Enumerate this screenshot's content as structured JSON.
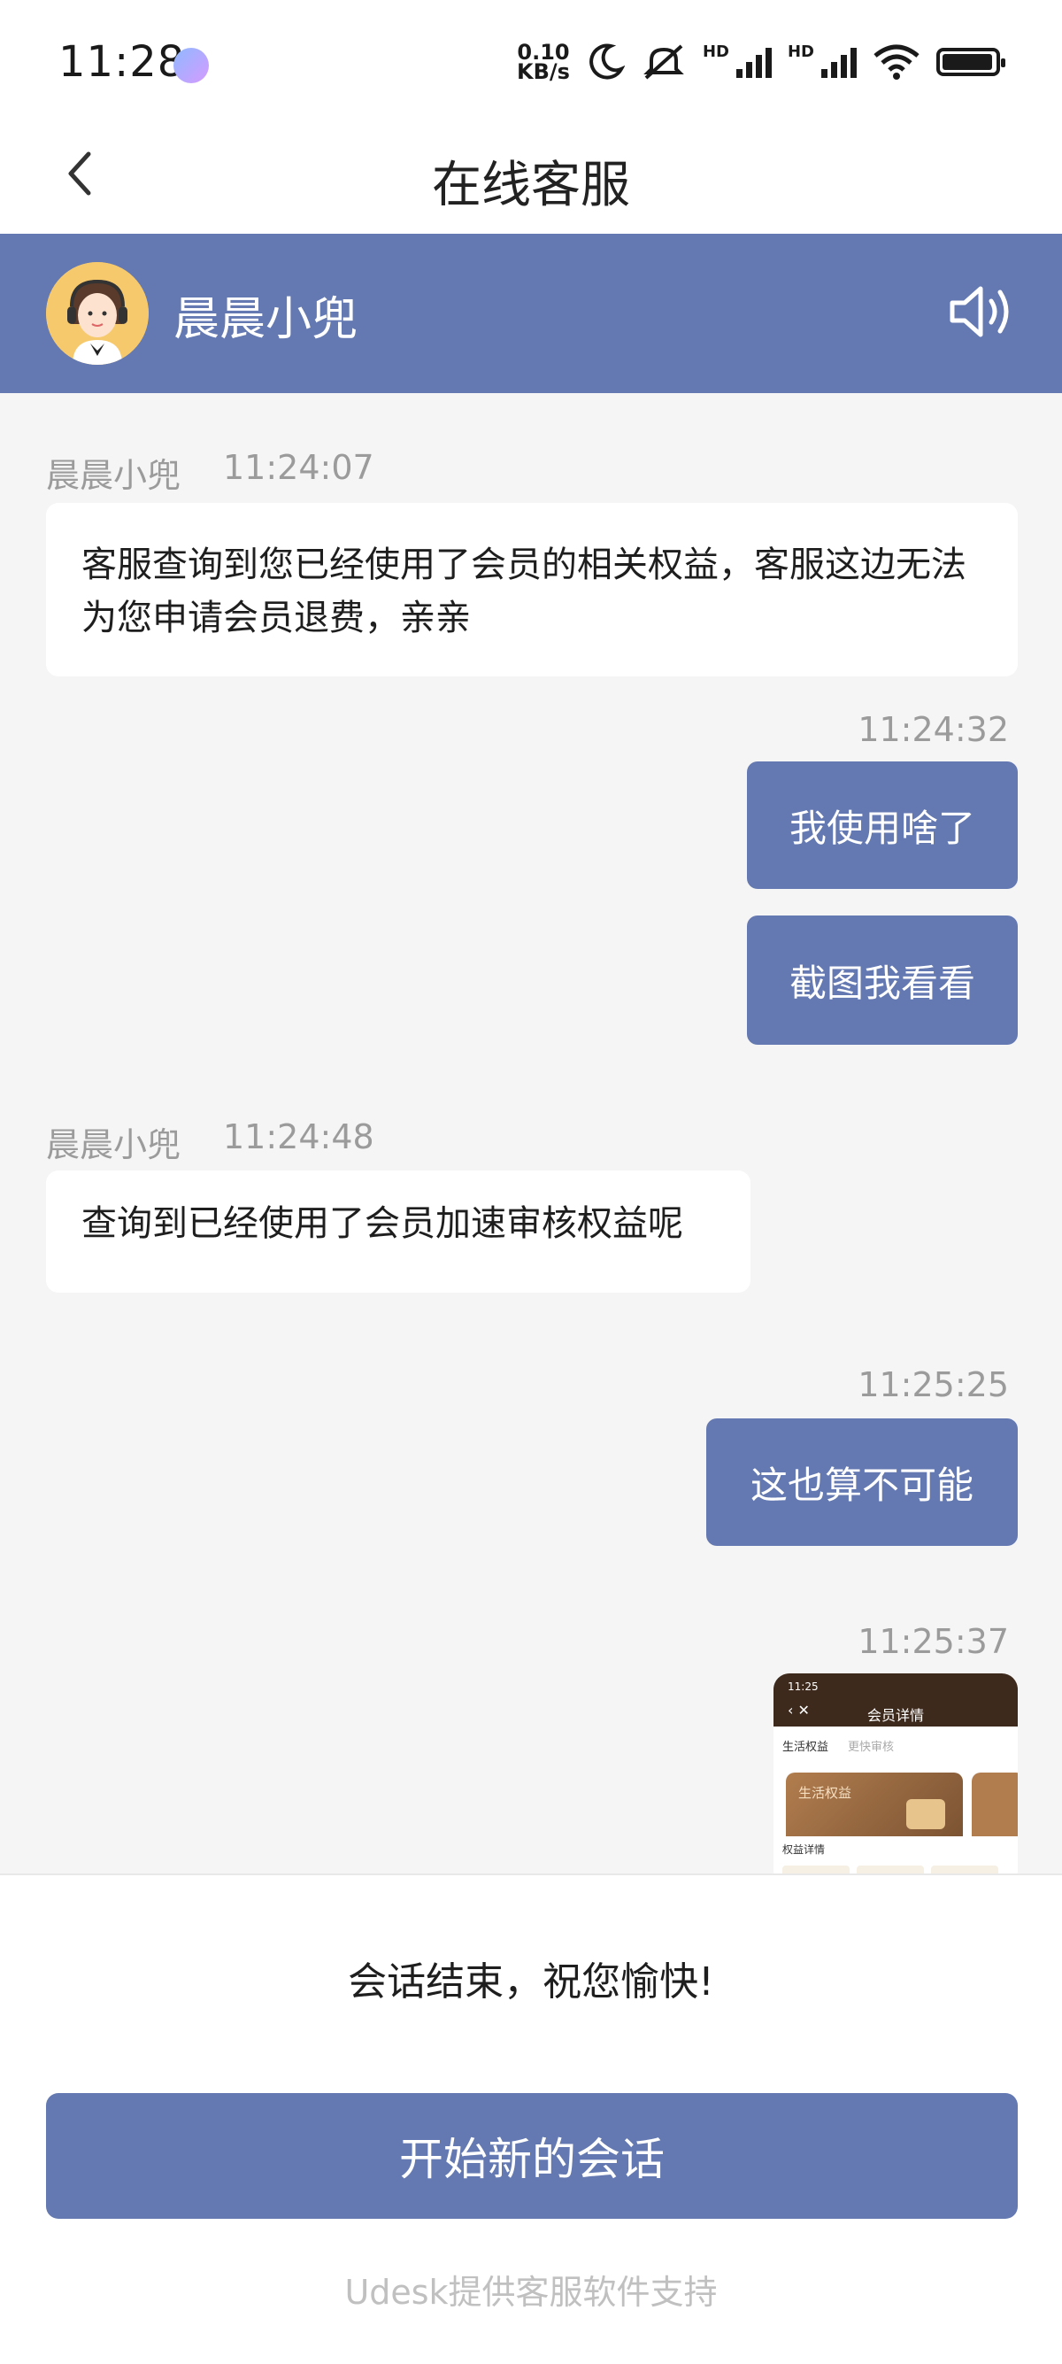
{
  "status": {
    "time": "11:28",
    "net_speed_value": "0.10",
    "net_speed_unit": "KB/s",
    "hd1": "HD",
    "hd2": "HD"
  },
  "nav": {
    "title": "在线客服"
  },
  "agent": {
    "name": "晨晨小兜"
  },
  "messages": {
    "m1": {
      "sender": "晨晨小兜",
      "time": "11:24:07",
      "text": "客服查询到您已经使用了会员的相关权益，客服这边无法为您申请会员退费，亲亲"
    },
    "m2": {
      "time": "11:24:32",
      "text": "我使用啥了"
    },
    "m3": {
      "text": "截图我看看"
    },
    "m4": {
      "sender": "晨晨小兜",
      "time": "11:24:48",
      "text": "查询到已经使用了会员加速审核权益呢"
    },
    "m5": {
      "time": "11:25:25",
      "text": "这也算不可能"
    },
    "m6": {
      "time": "11:25:37",
      "thumb": {
        "status_time": "11:25",
        "title": "会员详情",
        "tab_active": "生活权益",
        "tab_other": "更快审核",
        "card_label": "生活权益",
        "detail_label": "权益详情"
      }
    }
  },
  "footer": {
    "ended_text": "会话结束，祝您愉快!",
    "new_session_label": "开始新的会话",
    "powered_by": "Udesk提供客服软件支持"
  },
  "colors": {
    "accent": "#6479b1",
    "background": "#f5f5f5"
  }
}
